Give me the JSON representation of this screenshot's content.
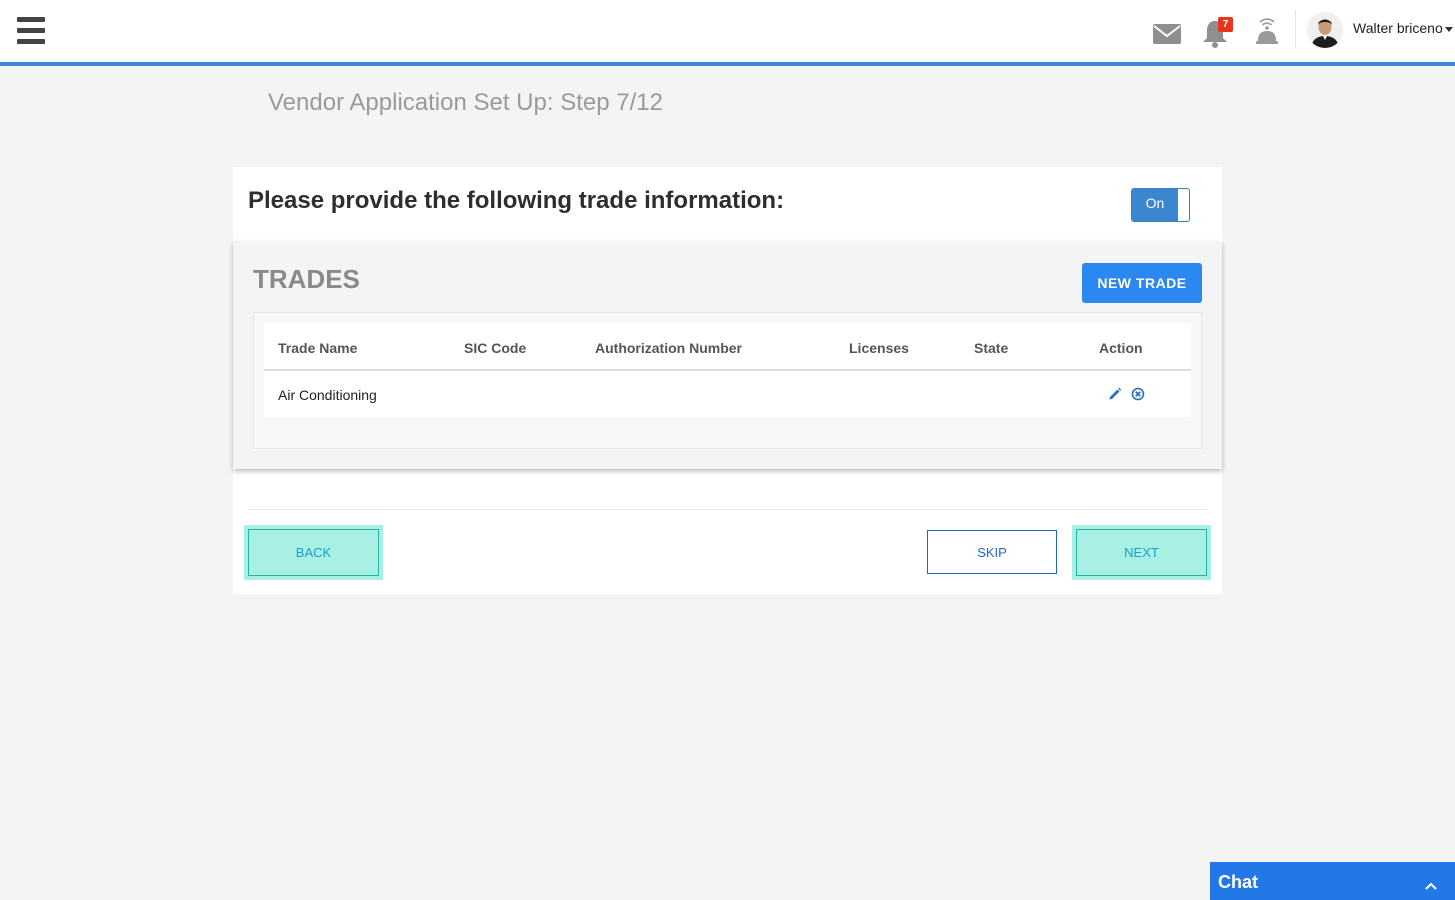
{
  "header": {
    "notification_count": "7",
    "user_name": "Walter briceno",
    "icons": [
      "menu-icon",
      "mail-icon",
      "bell-icon",
      "signal-bell-icon",
      "avatar",
      "caret-down-icon"
    ],
    "accent_color": "#3a86d8"
  },
  "page": {
    "title": "Vendor Application Set Up: Step 7/12"
  },
  "card": {
    "heading": "Please provide the following trade information:",
    "toggle_label": "On"
  },
  "trades": {
    "title": "TRADES",
    "new_trade_label": "NEW TRADE",
    "columns": [
      "Trade Name",
      "SIC Code",
      "Authorization Number",
      "Licenses",
      "State",
      "Action"
    ],
    "rows": [
      {
        "trade_name": "Air Conditioning",
        "sic_code": "",
        "authorization_number": "",
        "licenses": "",
        "state": ""
      }
    ]
  },
  "footer": {
    "back_label": "BACK",
    "skip_label": "SKIP",
    "next_label": "NEXT"
  },
  "chat": {
    "label": "Chat"
  },
  "colors": {
    "primary_button": "#2b88f0",
    "highlight": "#a8efe4",
    "chat_bar": "#2378e8",
    "badge": "#e8351c"
  }
}
